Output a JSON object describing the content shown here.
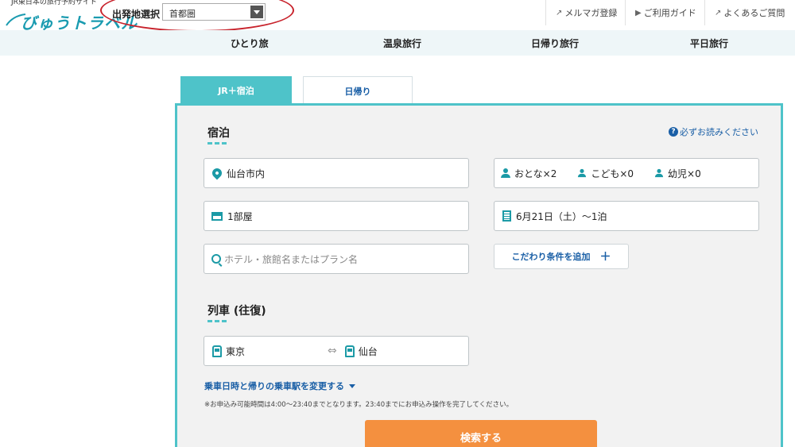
{
  "header": {
    "logo_tagline": "JR東日本の旅行予約サイト",
    "logo_text": "びゅうトラベル",
    "departure_label": "出発地選択",
    "departure_value": "首都圏",
    "links": [
      {
        "label": "メルマガ登録",
        "icon": "external-link-icon"
      },
      {
        "label": "ご利用ガイド",
        "icon": "triangle-right-icon"
      },
      {
        "label": "よくあるご質問",
        "icon": "external-link-icon"
      }
    ]
  },
  "nav": {
    "items": [
      "ひとり旅",
      "温泉旅行",
      "日帰り旅行",
      "平日旅行"
    ]
  },
  "tabs": {
    "active": "JR＋宿泊",
    "inactive": "日帰り"
  },
  "lodging": {
    "title": "宿泊",
    "must_read": "必ずお読みください",
    "destination": "仙台市内",
    "rooms": "1部屋",
    "keyword_placeholder": "ホテル・旅館名またはプラン名",
    "adults": "おとな×2",
    "children": "こども×0",
    "infants": "幼児×0",
    "date": "6月21日（土）～1泊",
    "add_conditions": "こだわり条件を追加",
    "add_plus": "＋"
  },
  "train": {
    "title": "列車 (往復)",
    "from": "東京",
    "to": "仙台",
    "swap_icon": "⇔",
    "change_link": "乗車日時と帰りの乗車駅を変更する",
    "note": "※お申込み可能時間は4:00～23:40までとなります。23:40までにお申込み操作を完了してください。"
  },
  "search_button": "検索する",
  "colors": {
    "accent": "#4ec3c9",
    "link": "#1a5fa6",
    "search": "#f4903f",
    "highlight_oval": "#c8232c"
  }
}
